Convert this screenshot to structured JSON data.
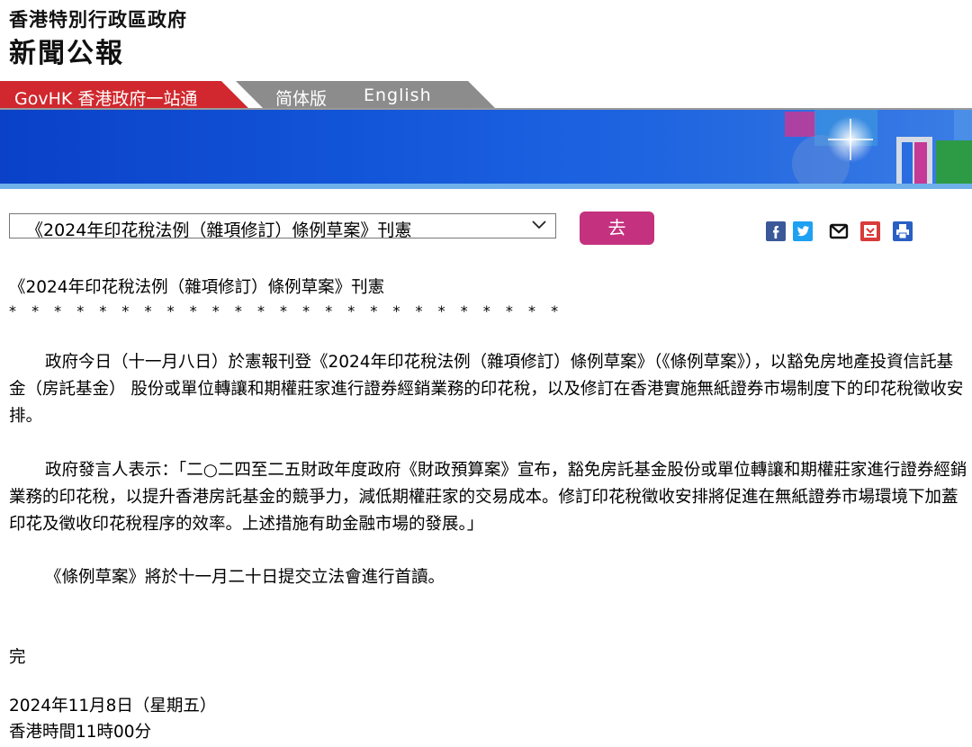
{
  "header": {
    "gov_name": "香港特別行政區政府",
    "press_title": "新聞公報"
  },
  "nav": {
    "govhk": "GovHK 香港政府一站通",
    "simplified": "简体版",
    "english": "English"
  },
  "toolbar": {
    "selected_article": "《2024年印花稅法例（雜項修訂）條例草案》刊憲",
    "go_label": "去",
    "share_icons": [
      "facebook-icon",
      "twitter-icon",
      "email-icon",
      "bookmark-icon",
      "print-icon"
    ]
  },
  "colors": {
    "nav_red": "#d0282e",
    "nav_grey": "#8c8c8c",
    "go_button": "#c4317f",
    "banner_blue": "#1254d8"
  },
  "article": {
    "title": "《2024年印花稅法例（雜項修訂）條例草案》刊憲",
    "stars": "* * * * * * * * * * * * * * * * * * * * * * * * *",
    "paragraphs": [
      "政府今日（十一月八日）於憲報刊登《2024年印花稅法例（雜項修訂）條例草案》（《條例草案》），以豁免房地產投資信託基金（房託基金） 股份或單位轉讓和期權莊家進行證券經銷業務的印花稅，以及修訂在香港實施無紙證券市場制度下的印花稅徵收安排。",
      "政府發言人表示：「二○二四至二五財政年度政府《財政預算案》宣布，豁免房託基金股份或單位轉讓和期權莊家進行證券經銷業務的印花稅，以提升香港房託基金的競爭力，減低期權莊家的交易成本。修訂印花稅徵收安排將促進在無紙證券市場環境下加蓋印花及徵收印花稅程序的效率。上述措施有助金融市場的發展。」",
      "《條例草案》將於十一月二十日提交立法會進行首讀。"
    ],
    "end_mark": "完",
    "date": "2024年11月8日（星期五）",
    "time": "香港時間11時00分"
  }
}
